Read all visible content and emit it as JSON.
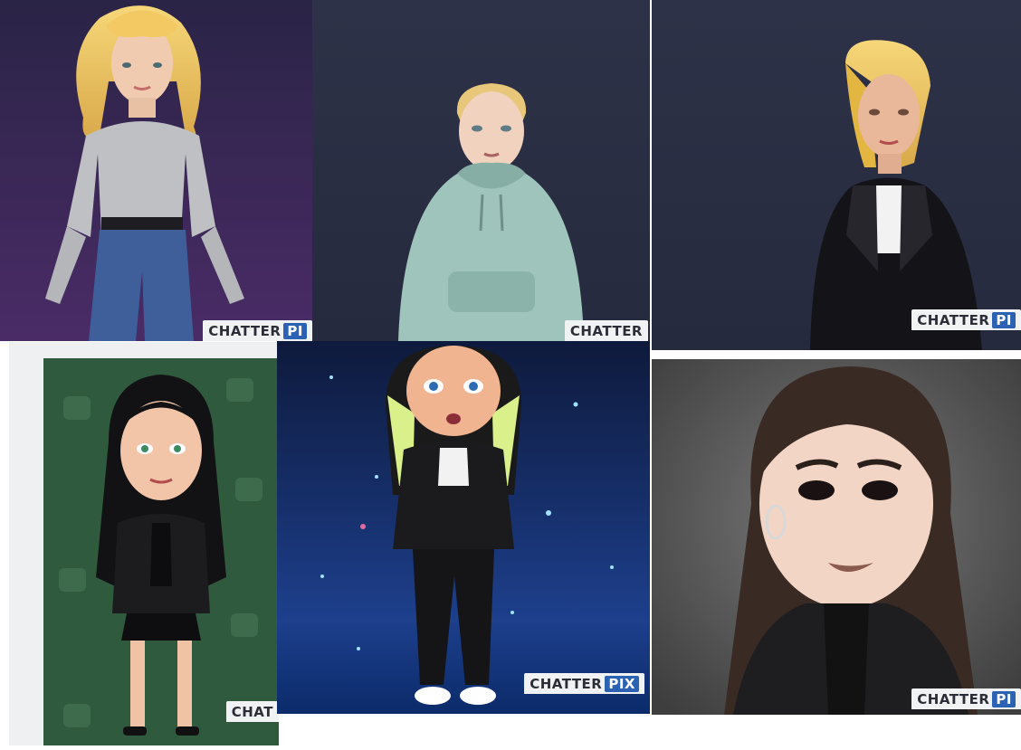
{
  "image": {
    "tiles": [
      {
        "subject": "3D avatar, blonde braided hair, grey knit sweater, blue jeans",
        "watermark": {
          "text": "CHATTER",
          "badge": "PI"
        }
      },
      {
        "subject": "3D avatar, short blonde hair, mint green hoodie",
        "watermark": {
          "text": "CHATTER",
          "badge": ""
        }
      },
      {
        "subject": "3D avatar, blonde ponytail, black leather jacket",
        "watermark": {
          "text": "CHATTER",
          "badge": "PI"
        }
      },
      {
        "subject": "cartoon avatar, long black hair, black leather jacket and skirt, green patterned background",
        "watermark": {
          "text": "CHAT",
          "badge": ""
        }
      },
      {
        "subject": "cartoon avatar, blonde and black hair, black leather jacket, starry blue background",
        "watermark": {
          "text": "CHATTER",
          "badge": "PIX"
        }
      },
      {
        "subject": "cartoon avatar close-up, long dark brown hair, hoop earrings, black jacket",
        "watermark": {
          "text": "CHATTER",
          "badge": "PI"
        }
      }
    ]
  }
}
